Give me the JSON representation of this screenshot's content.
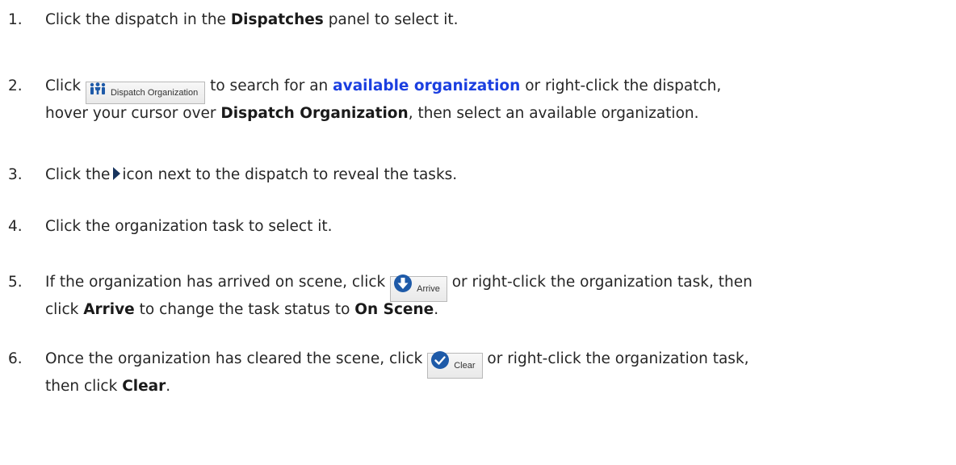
{
  "steps": [
    {
      "number": "1.",
      "t1": "Click the dispatch in the ",
      "b1": "Dispatches",
      "t2": " panel to select it."
    },
    {
      "number": "2.",
      "t1": "Click",
      "button_label": "Dispatch Organization",
      "button_icon": "people-icon",
      "t2": " to search for an ",
      "link": "available organization",
      "t3": " or right-click the dispatch,",
      "t4": "hover your cursor over ",
      "b1": "Dispatch Organization",
      "t5": ", then select an available organization."
    },
    {
      "number": "3.",
      "t1": "Click the",
      "icon": "expand-triangle-icon",
      "t2": "icon next to the dispatch to reveal the tasks."
    },
    {
      "number": "4.",
      "t1": "Click the organization task to select it."
    },
    {
      "number": "5.",
      "t1": "If the organization has arrived on scene, click",
      "button_label": "Arrive",
      "button_icon": "arrive-down-arrow-icon",
      "t2": " or right-click the organization task, then",
      "t3": "click ",
      "b1": "Arrive",
      "t4": " to change the task status to ",
      "b2": "On Scene",
      "t5": "."
    },
    {
      "number": "6.",
      "t1": "Once the organization has cleared the scene, click",
      "button_label": "Clear",
      "button_icon": "clear-check-icon",
      "t2": " or right-click the organization task,",
      "t3": "then click ",
      "b1": "Clear",
      "t4": "."
    }
  ],
  "colors": {
    "text": "#262626",
    "link": "#1b3fe0",
    "icon_blue": "#1e5aa8",
    "icon_dark_blue": "#17345e"
  }
}
